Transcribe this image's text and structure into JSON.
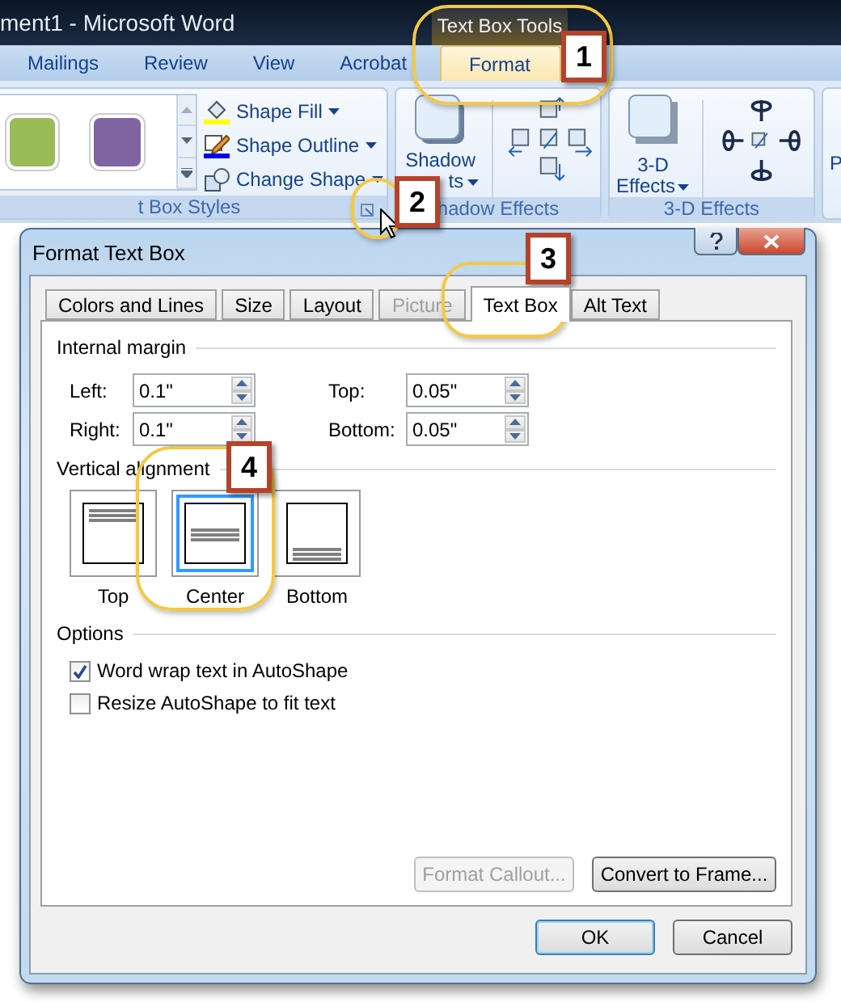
{
  "window": {
    "title": "ment1 - Microsoft Word",
    "context_tab_group": "Text Box Tools"
  },
  "ribbon_tabs": [
    {
      "label": "Mailings",
      "selected": false
    },
    {
      "label": "Review",
      "selected": false
    },
    {
      "label": "View",
      "selected": false
    },
    {
      "label": "Acrobat",
      "selected": false
    },
    {
      "label": "Format",
      "selected": true
    }
  ],
  "ribbon": {
    "styles_group": {
      "label": "t Box Styles",
      "swatches": [
        {
          "color": "#9bbb59"
        },
        {
          "color": "#8064a2"
        }
      ],
      "commands": [
        {
          "label": "Shape Fill",
          "kind": "fill"
        },
        {
          "label": "Shape Outline",
          "kind": "outline"
        },
        {
          "label": "Change Shape",
          "kind": "change"
        }
      ]
    },
    "shadow_group": {
      "label": "hadow Effects",
      "button": [
        "Shadow",
        "ts"
      ]
    },
    "effects_group": {
      "label": "3-D Effects",
      "button": [
        "3-D",
        "Effects"
      ]
    },
    "next_group": {
      "button": "P"
    }
  },
  "dialog": {
    "title": "Format Text Box",
    "tabs": [
      {
        "label": "Colors and Lines",
        "selected": false,
        "disabled": false
      },
      {
        "label": "Size",
        "selected": false,
        "disabled": false
      },
      {
        "label": "Layout",
        "selected": false,
        "disabled": false
      },
      {
        "label": "Picture",
        "selected": false,
        "disabled": true
      },
      {
        "label": "Text Box",
        "selected": true,
        "disabled": false
      },
      {
        "label": "Alt Text",
        "selected": false,
        "disabled": false
      }
    ],
    "internal_margin": {
      "title": "Internal margin",
      "fields": [
        {
          "label": "Left:",
          "value": "0.1\""
        },
        {
          "label": "Top:",
          "value": "0.05\""
        },
        {
          "label": "Right:",
          "value": "0.1\""
        },
        {
          "label": "Bottom:",
          "value": "0.05\""
        }
      ]
    },
    "vertical_alignment": {
      "title": "Vertical alignment",
      "options": [
        {
          "label": "Top",
          "kind": "top",
          "selected": false
        },
        {
          "label": "Center",
          "kind": "center",
          "selected": true
        },
        {
          "label": "Bottom",
          "kind": "bottom",
          "selected": false
        }
      ]
    },
    "options": {
      "title": "Options",
      "checkboxes": [
        {
          "label": "Word wrap text in AutoShape",
          "checked": true
        },
        {
          "label": "Resize AutoShape to fit text",
          "checked": false
        }
      ]
    },
    "panel_buttons": [
      {
        "label": "Format Callout...",
        "disabled": true
      },
      {
        "label": "Convert to Frame...",
        "disabled": false
      }
    ],
    "buttons": [
      {
        "label": "OK",
        "default": true
      },
      {
        "label": "Cancel",
        "default": false
      }
    ]
  },
  "callouts": [
    {
      "number": "1"
    },
    {
      "number": "2"
    },
    {
      "number": "3"
    },
    {
      "number": "4"
    }
  ]
}
